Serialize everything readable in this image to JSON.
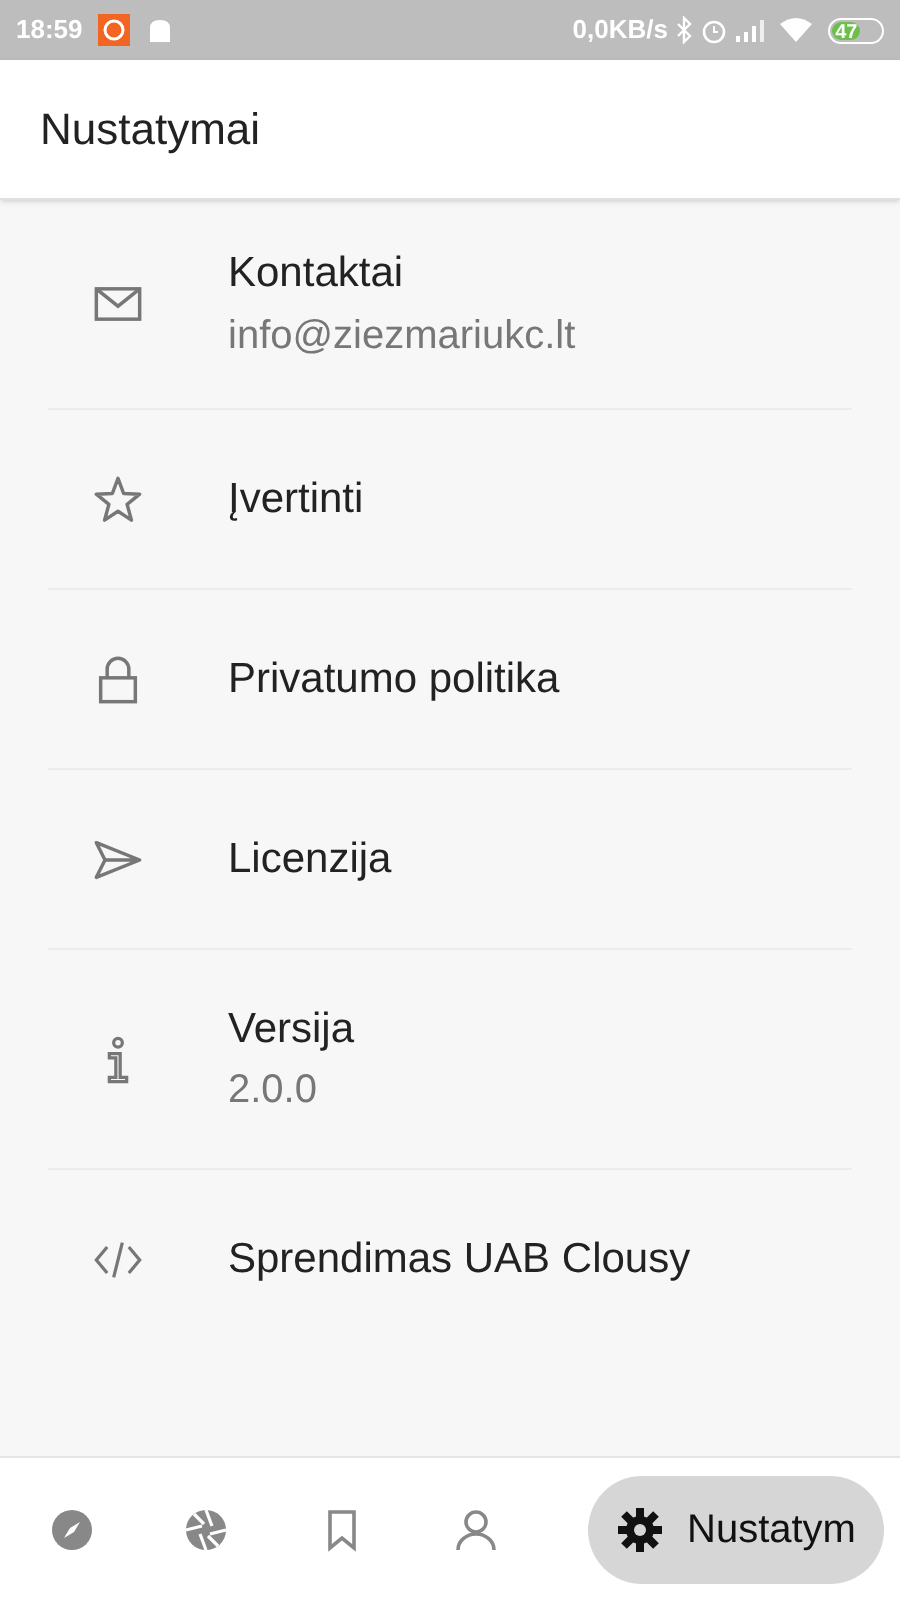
{
  "status_bar": {
    "time": "18:59",
    "speed": "0,0KB/s",
    "battery": "47"
  },
  "app_bar": {
    "title": "Nustatymai"
  },
  "items": [
    {
      "title": "Kontaktai",
      "subtitle": "info@ziezmariukc.lt"
    },
    {
      "title": "Įvertinti"
    },
    {
      "title": "Privatumo politika"
    },
    {
      "title": "Licenzija"
    },
    {
      "title": "Versija",
      "subtitle": "2.0.0"
    },
    {
      "title": "Sprendimas UAB Clousy"
    }
  ],
  "bottom_nav": [
    {
      "selected": false
    },
    {
      "selected": false
    },
    {
      "selected": false
    },
    {
      "selected": false
    },
    {
      "selected": true,
      "label": "Nustatym"
    }
  ]
}
